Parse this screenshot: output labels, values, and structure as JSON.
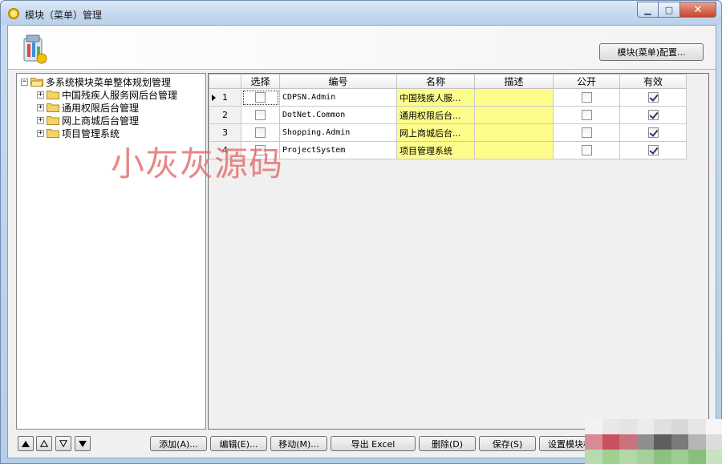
{
  "window": {
    "title": "模块（菜单）管理",
    "minimize_glyph": "▁",
    "maximize_glyph": "□",
    "close_glyph": "✕"
  },
  "header": {
    "config_button": "模块(菜单)配置..."
  },
  "tree": {
    "root": "多系统模块菜单整体规划管理",
    "root_expander": "−",
    "children": [
      {
        "label": "中国残疾人服务网后台管理",
        "expander": "+"
      },
      {
        "label": "通用权限后台管理",
        "expander": "+"
      },
      {
        "label": "网上商城后台管理",
        "expander": "+"
      },
      {
        "label": "项目管理系统",
        "expander": "+"
      }
    ]
  },
  "grid": {
    "columns": [
      "选择",
      "编号",
      "名称",
      "描述",
      "公开",
      "有效"
    ],
    "rows": [
      {
        "index": "1",
        "selected": false,
        "code": "CDPSN.Admin",
        "name": "中国残疾人服...",
        "description": "",
        "public": false,
        "valid": true
      },
      {
        "index": "2",
        "selected": false,
        "code": "DotNet.Common",
        "name": "通用权限后台...",
        "description": "",
        "public": false,
        "valid": true
      },
      {
        "index": "3",
        "selected": false,
        "code": "Shopping.Admin",
        "name": "网上商城后台...",
        "description": "",
        "public": false,
        "valid": true
      },
      {
        "index": "4",
        "selected": false,
        "code": "ProjectSystem",
        "name": "项目管理系统",
        "description": "",
        "public": false,
        "valid": true
      }
    ],
    "current_row": 0
  },
  "toolbar": {
    "add": "添加(A)...",
    "edit": "编辑(E)...",
    "move": "移动(M)...",
    "export": "导出 Excel",
    "delete": "删除(D)",
    "save": "保存(S)",
    "set_module": "设置模块权"
  },
  "watermark": "小灰灰源码",
  "colors": {
    "description_highlight": "#fdfd8c",
    "window_frame": "#b5cde6",
    "watermark": "#e26e6e"
  }
}
